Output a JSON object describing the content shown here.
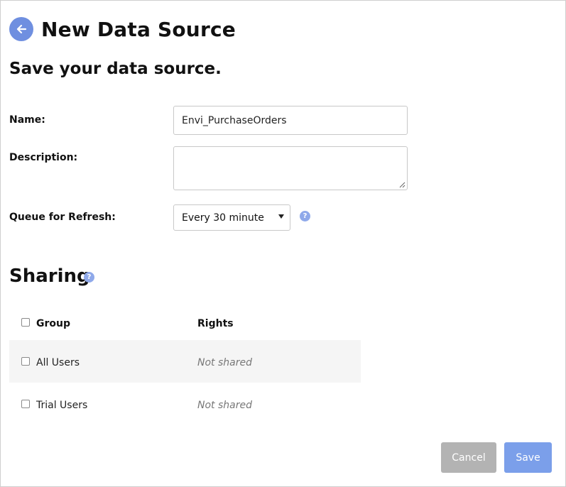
{
  "header": {
    "title": "New Data Source",
    "back_icon": "arrow-left-icon"
  },
  "subtitle": "Save your data source.",
  "form": {
    "name_label": "Name:",
    "name_value": "Envi_PurchaseOrders",
    "description_label": "Description:",
    "description_value": "",
    "queue_label": "Queue for Refresh:",
    "queue_value": "Every 30 minute",
    "help_icon": "?"
  },
  "sharing": {
    "title": "Sharing",
    "help_icon": "?",
    "columns": {
      "group": "Group",
      "rights": "Rights"
    },
    "rows": [
      {
        "group": "All Users",
        "rights": "Not shared"
      },
      {
        "group": "Trial Users",
        "rights": "Not shared"
      }
    ]
  },
  "buttons": {
    "cancel": "Cancel",
    "save": "Save"
  },
  "colors": {
    "accent": "#6f8fe0",
    "save_button": "#7b9fea",
    "cancel_button": "#b3b3b3",
    "help_icon": "#8fa9ea",
    "shaded_row": "#f5f5f5"
  }
}
